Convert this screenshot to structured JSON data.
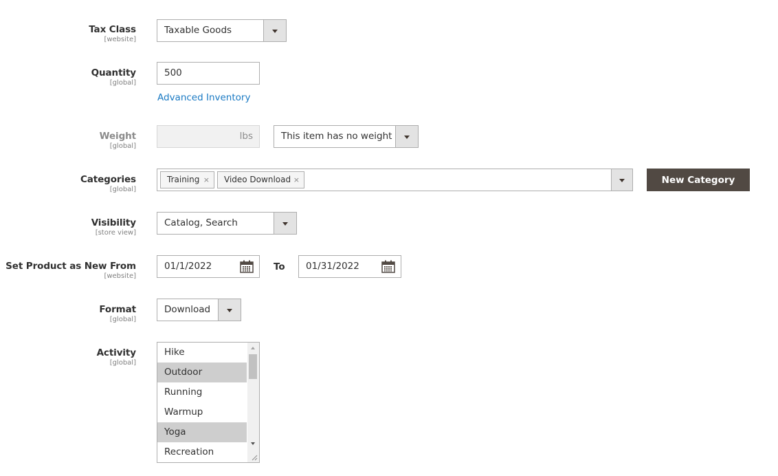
{
  "fields": {
    "tax_class": {
      "label": "Tax Class",
      "scope": "[website]",
      "value": "Taxable Goods"
    },
    "quantity": {
      "label": "Quantity",
      "scope": "[global]",
      "value": "500",
      "link": "Advanced Inventory"
    },
    "weight": {
      "label": "Weight",
      "scope": "[global]",
      "value": "",
      "unit": "lbs",
      "weight_option": "This item has no weight"
    },
    "categories": {
      "label": "Categories",
      "scope": "[global]",
      "chips": [
        "Training",
        "Video Download"
      ],
      "chip_remove": "×",
      "new_category_button": "New Category"
    },
    "visibility": {
      "label": "Visibility",
      "scope": "[store view]",
      "value": "Catalog, Search"
    },
    "new_from": {
      "label": "Set Product as New From",
      "scope": "[website]",
      "from_value": "01/1/2022",
      "to_label": "To",
      "to_value": "01/31/2022"
    },
    "format": {
      "label": "Format",
      "scope": "[global]",
      "value": "Download"
    },
    "activity": {
      "label": "Activity",
      "scope": "[global]",
      "options": [
        {
          "label": "Hike",
          "selected": false
        },
        {
          "label": "Outdoor",
          "selected": true
        },
        {
          "label": "Running",
          "selected": false
        },
        {
          "label": "Warmup",
          "selected": false
        },
        {
          "label": "Yoga",
          "selected": true
        },
        {
          "label": "Recreation",
          "selected": false
        }
      ]
    }
  },
  "colors": {
    "link": "#1979c3",
    "primary_button": "#514943",
    "selected_option": "#cecece"
  }
}
